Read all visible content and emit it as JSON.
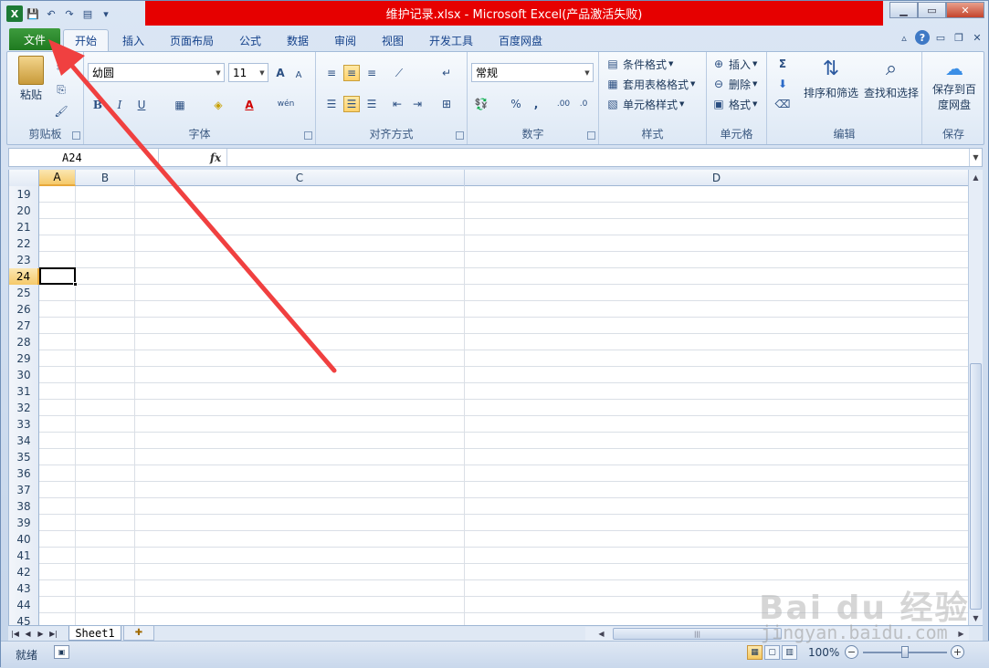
{
  "window": {
    "title": "维护记录.xlsx - Microsoft Excel(产品激活失败)"
  },
  "qat": {
    "excel_icon": "X",
    "save": "💾",
    "undo": "↶",
    "redo": "↷",
    "form": "▤"
  },
  "tabs": {
    "file": "文件",
    "items": [
      "开始",
      "插入",
      "页面布局",
      "公式",
      "数据",
      "审阅",
      "视图",
      "开发工具",
      "百度网盘"
    ]
  },
  "ribbon": {
    "clipboard": {
      "label": "剪贴板",
      "paste": "粘贴"
    },
    "font": {
      "label": "字体",
      "font_name": "幼圆",
      "font_size": "11",
      "bold": "B",
      "italic": "I",
      "underline": "U",
      "grow": "A",
      "shrink": "A",
      "color_a": "A",
      "phonetic": "wén"
    },
    "alignment": {
      "label": "对齐方式"
    },
    "number": {
      "label": "数字",
      "format": "常规",
      "percent": "%",
      "comma": ","
    },
    "styles": {
      "label": "样式",
      "conditional": "条件格式",
      "table": "套用表格格式",
      "cell": "单元格样式"
    },
    "cells": {
      "label": "单元格",
      "insert": "插入",
      "delete": "删除",
      "format": "格式"
    },
    "editing": {
      "label": "编辑",
      "sort": "排序和筛选",
      "find": "查找和选择",
      "sigma": "Σ"
    },
    "save": {
      "label": "保存",
      "line1": "保存到百",
      "line2": "度网盘"
    }
  },
  "formula_bar": {
    "name_box": "A24",
    "fx": "fx",
    "value": ""
  },
  "grid": {
    "columns": [
      "A",
      "B",
      "C",
      "D"
    ],
    "rows": [
      "19",
      "20",
      "21",
      "22",
      "23",
      "24",
      "25",
      "26",
      "27",
      "28",
      "29",
      "30",
      "31",
      "32",
      "33",
      "34",
      "35",
      "36",
      "37",
      "38",
      "39",
      "40",
      "41",
      "42",
      "43",
      "44",
      "45"
    ],
    "active_cell": "A24"
  },
  "sheets": {
    "tabs": [
      "Sheet1"
    ]
  },
  "status": {
    "ready": "就绪",
    "zoom": "100%"
  },
  "watermark": {
    "line1": "Bai du 经验",
    "line2": "jingyan.baidu.com"
  }
}
